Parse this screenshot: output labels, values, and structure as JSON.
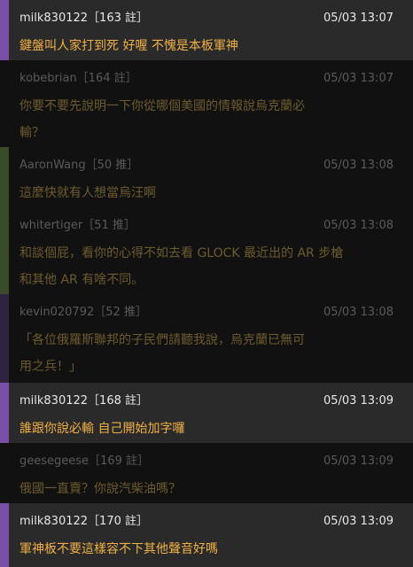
{
  "comments": [
    {
      "author": "milk830122［163 註］",
      "date": "05/03 13:07",
      "lines": [
        "鍵盤叫人家打到死 好喔 不愧是本板軍神"
      ]
    },
    {
      "author": "kobebrian［164 註］",
      "date": "05/03 13:07",
      "lines": [
        "你要不要先說明一下你從哪個美國的情報說烏克蘭必",
        "輸？"
      ]
    },
    {
      "author": "AaronWang［50 推］",
      "date": "05/03 13:08",
      "lines": [
        "這麼快就有人想當烏汪啊"
      ]
    },
    {
      "author": "whitertiger［51 推］",
      "date": "05/03 13:08",
      "lines": [
        "和談個屁，看你的心得不如去看 GLOCK 最近出的 AR 步槍",
        "和其他 AR 有啥不同。"
      ]
    },
    {
      "author": "kevin020792［52 推］",
      "date": "05/03 13:08",
      "lines": [
        "「各位俄羅斯聯邦的子民們請聽我說，烏克蘭已無可",
        "用之兵！」"
      ]
    },
    {
      "author": "milk830122［168 註］",
      "date": "05/03 13:09",
      "lines": [
        "誰跟你說必輸 自己開始加字囉"
      ]
    },
    {
      "author": "geesegeese［169 註］",
      "date": "05/03 13:09",
      "lines": [
        "俄國一直賣？你說汽柴油嗎？"
      ]
    },
    {
      "author": "milk830122［170 註］",
      "date": "05/03 13:09",
      "lines": [
        "軍神板不要這樣容不下其他聲音好嗎"
      ]
    }
  ]
}
